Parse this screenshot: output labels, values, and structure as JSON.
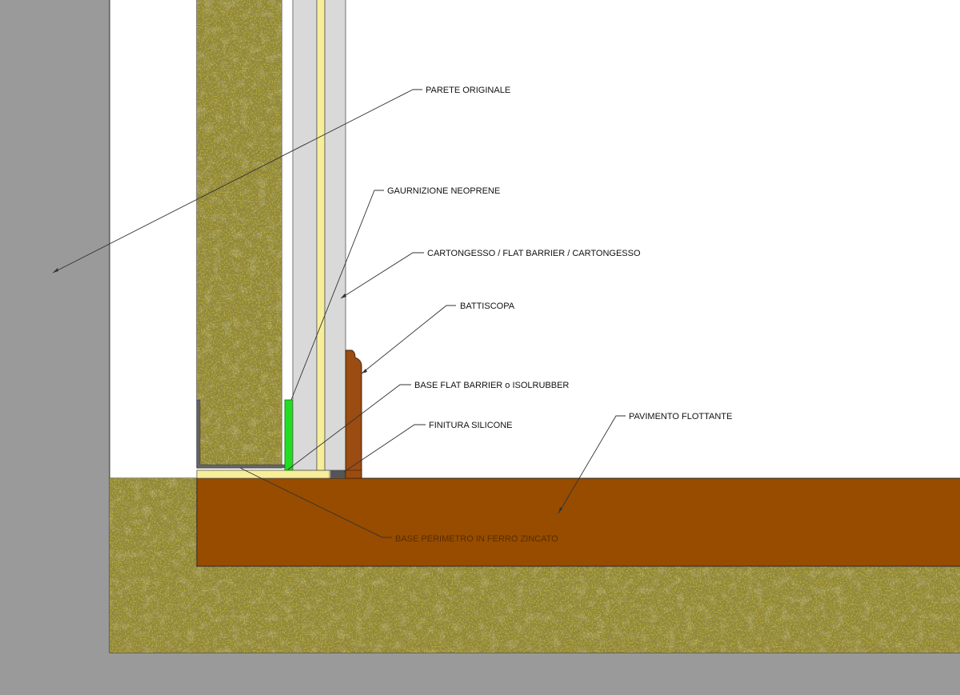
{
  "labels": {
    "parete_originale": "PARETE ORIGINALE",
    "guarnizione_neoprene": "GAURNIZIONE NEOPRENE",
    "cartongesso": "CARTONGESSO / FLAT BARRIER / CARTONGESSO",
    "battiscopa": "BATTISCOPA",
    "base_flat_barrier": "BASE FLAT BARRIER o ISOLRUBBER",
    "finitura_silicone": "FINITURA SILICONE",
    "pavimento_flottante": "PAVIMENTO FLOTTANTE",
    "base_perimetro": "BASE PERIMETRO IN FERRO ZINCATO"
  },
  "colors": {
    "background": "#9a9a9a",
    "paper": "#ffffff",
    "concrete": "#b5a93a",
    "floor": "#974c00",
    "gypsum": "#d9d9d9",
    "flat_barrier": "#f7ee9a",
    "neoprene": "#22dd22",
    "skirting": "#9a4c12",
    "silicone": "#555555",
    "steel": "#666666"
  }
}
